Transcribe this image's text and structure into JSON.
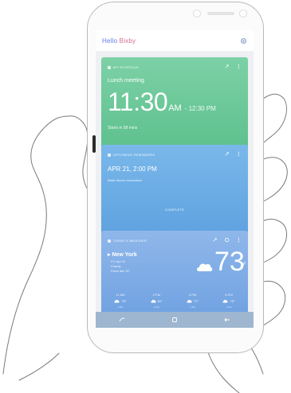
{
  "app": {
    "greeting_hello": "Hello",
    "greeting_name": "Bixby"
  },
  "cards": {
    "meeting": {
      "label": "MY SCHEDULE",
      "title": "Lunch meeting",
      "start": "11:30",
      "ampm": "AM",
      "end": "- 12:30 PM",
      "sub": "Starts in 58 mins"
    },
    "reminder": {
      "label": "UPCOMING REMINDERS",
      "time": "APR 21, 2:00 PM",
      "note": "Make dinner reservation",
      "complete": "COMPLETE"
    },
    "weather": {
      "label": "TODAY'S WEATHER",
      "city": "New York",
      "details": [
        "Fri, Apr 21",
        "Cloudy",
        "Feels like 76°"
      ],
      "temp": "73",
      "unit": "F",
      "forecast": [
        {
          "time": "11 AM",
          "temp": "73°",
          "rain": "1.5%"
        },
        {
          "time": "2 PM",
          "temp": "81°",
          "rain": "1.5%"
        },
        {
          "time": "5 PM",
          "temp": "77°",
          "rain": "1.5%"
        },
        {
          "time": "8 PM",
          "temp": "73°",
          "rain": "1.5%"
        }
      ]
    }
  },
  "colors": {
    "meeting_card": "#6cc898",
    "reminder_card": "#6aabe4",
    "weather_card": "#7eaae5",
    "nav_bar": "#9eb6cf"
  },
  "icons": {
    "settings": "gear-icon",
    "nav": [
      "back-icon",
      "home-icon",
      "recents-icon"
    ]
  }
}
